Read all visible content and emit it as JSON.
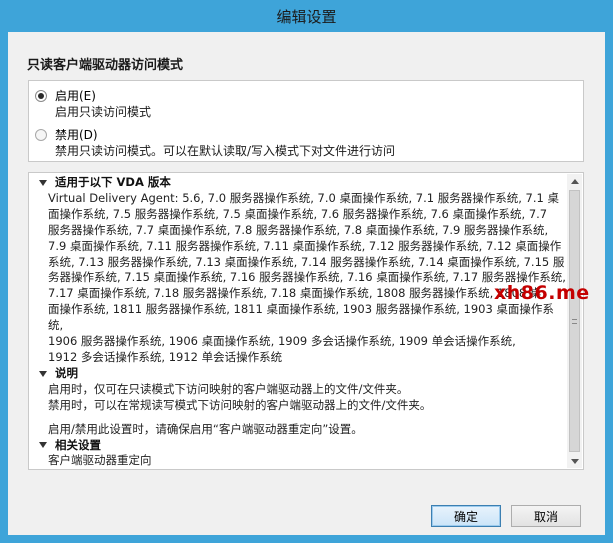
{
  "window": {
    "title": "编辑设置"
  },
  "section": {
    "title": "只读客户端驱动器访问模式"
  },
  "options": [
    {
      "label": "启用(E)",
      "description": "启用只读访问模式",
      "checked": true
    },
    {
      "label": "禁用(D)",
      "description": "禁用只读访问模式。可以在默认读取/写入模式下对文件进行访问",
      "checked": false
    }
  ],
  "info": {
    "versions": {
      "heading": "适用于以下 VDA 版本",
      "lines": [
        "Virtual Delivery Agent: 5.6, 7.0 服务器操作系统, 7.0 桌面操作系统, 7.1 服务器操作系统, 7.1 桌",
        "面操作系统, 7.5 服务器操作系统, 7.5 桌面操作系统, 7.6 服务器操作系统, 7.6 桌面操作系统, 7.7",
        "服务器操作系统, 7.7 桌面操作系统, 7.8 服务器操作系统, 7.8 桌面操作系统, 7.9 服务器操作系统,",
        "7.9 桌面操作系统, 7.11 服务器操作系统, 7.11 桌面操作系统, 7.12 服务器操作系统, 7.12 桌面操作",
        "系统, 7.13 服务器操作系统, 7.13 桌面操作系统, 7.14 服务器操作系统, 7.14 桌面操作系统, 7.15 服",
        "务器操作系统, 7.15 桌面操作系统, 7.16 服务器操作系统, 7.16 桌面操作系统, 7.17 服务器操作系统,",
        "7.17 桌面操作系统, 7.18 服务器操作系统, 7.18 桌面操作系统, 1808 服务器操作系统, 1808 桌",
        "面操作系统, 1811 服务器操作系统, 1811 桌面操作系统, 1903 服务器操作系统, 1903 桌面操作系统,",
        "1906 服务器操作系统, 1906 桌面操作系统, 1909 多会话操作系统, 1909 单会话操作系统,",
        "1912 多会话操作系统, 1912 单会话操作系统"
      ]
    },
    "description": {
      "heading": "说明",
      "line1": "启用时，仅可在只读模式下访问映射的客户端驱动器上的文件/文件夹。",
      "line2": "禁用时，可以在常规读写模式下访问映射的客户端驱动器上的文件/文件夹。",
      "line3": "启用/禁用此设置时，请确保启用“客户端驱动器重定向”设置。"
    },
    "related": {
      "heading": "相关设置",
      "item": "客户端驱动器重定向"
    }
  },
  "buttons": {
    "ok": "确定",
    "cancel": "取消"
  },
  "watermark": "xh86.me",
  "colors": {
    "frame": "#3ea4d9",
    "watermark": "#c40000",
    "ok_border": "#3c7fb1"
  }
}
